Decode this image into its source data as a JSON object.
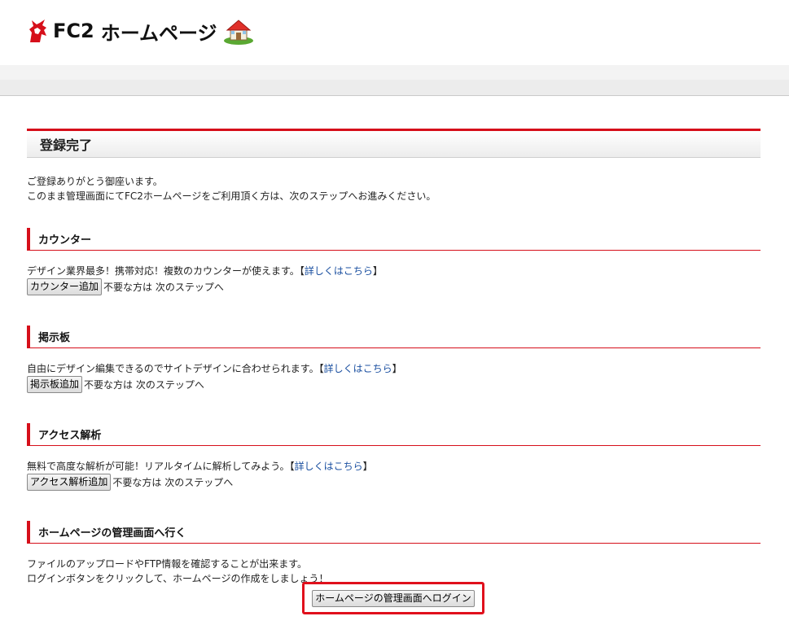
{
  "header": {
    "logo_fc2": "FC2",
    "logo_hp": "ホームページ",
    "logo_icon": "fc2-unicorn-icon",
    "house_icon": "house-icon"
  },
  "page": {
    "title": "登録完了",
    "intro_line1": "ご登録ありがとう御座います。",
    "intro_line2": "このまま管理画面にてFC2ホームページをご利用頂く方は、次のステップへお進みください。"
  },
  "sections": {
    "counter": {
      "heading": "カウンター",
      "desc": "デザイン業界最多！携帯対応！複数のカウンターが使えます。",
      "link_open": "【",
      "link": "詳しくはこちら",
      "link_close": "】",
      "button": "カウンター追加",
      "skip": "不要な方は 次のステップへ"
    },
    "board": {
      "heading": "掲示板",
      "desc": "自由にデザイン編集できるのでサイトデザインに合わせられます。",
      "link_open": "【",
      "link": "詳しくはこちら",
      "link_close": "】",
      "button": "掲示板追加",
      "skip": "不要な方は 次のステップへ"
    },
    "access": {
      "heading": "アクセス解析",
      "desc": "無料で高度な解析が可能！リアルタイムに解析してみよう。",
      "link_open": "【",
      "link": "詳しくはこちら",
      "link_close": "】",
      "button": "アクセス解析追加",
      "skip": "不要な方は 次のステップへ"
    },
    "admin": {
      "heading": "ホームページの管理画面へ行く",
      "desc_line1": "ファイルのアップロードやFTP情報を確認することが出来ます。",
      "desc_line2": "ログインボタンをクリックして、ホームページの作成をしましょう！",
      "button": "ホームページの管理画面へログイン"
    }
  },
  "colors": {
    "accent": "#d60f1a",
    "link": "#1a4fa0",
    "highlight_border": "#e0101c"
  }
}
